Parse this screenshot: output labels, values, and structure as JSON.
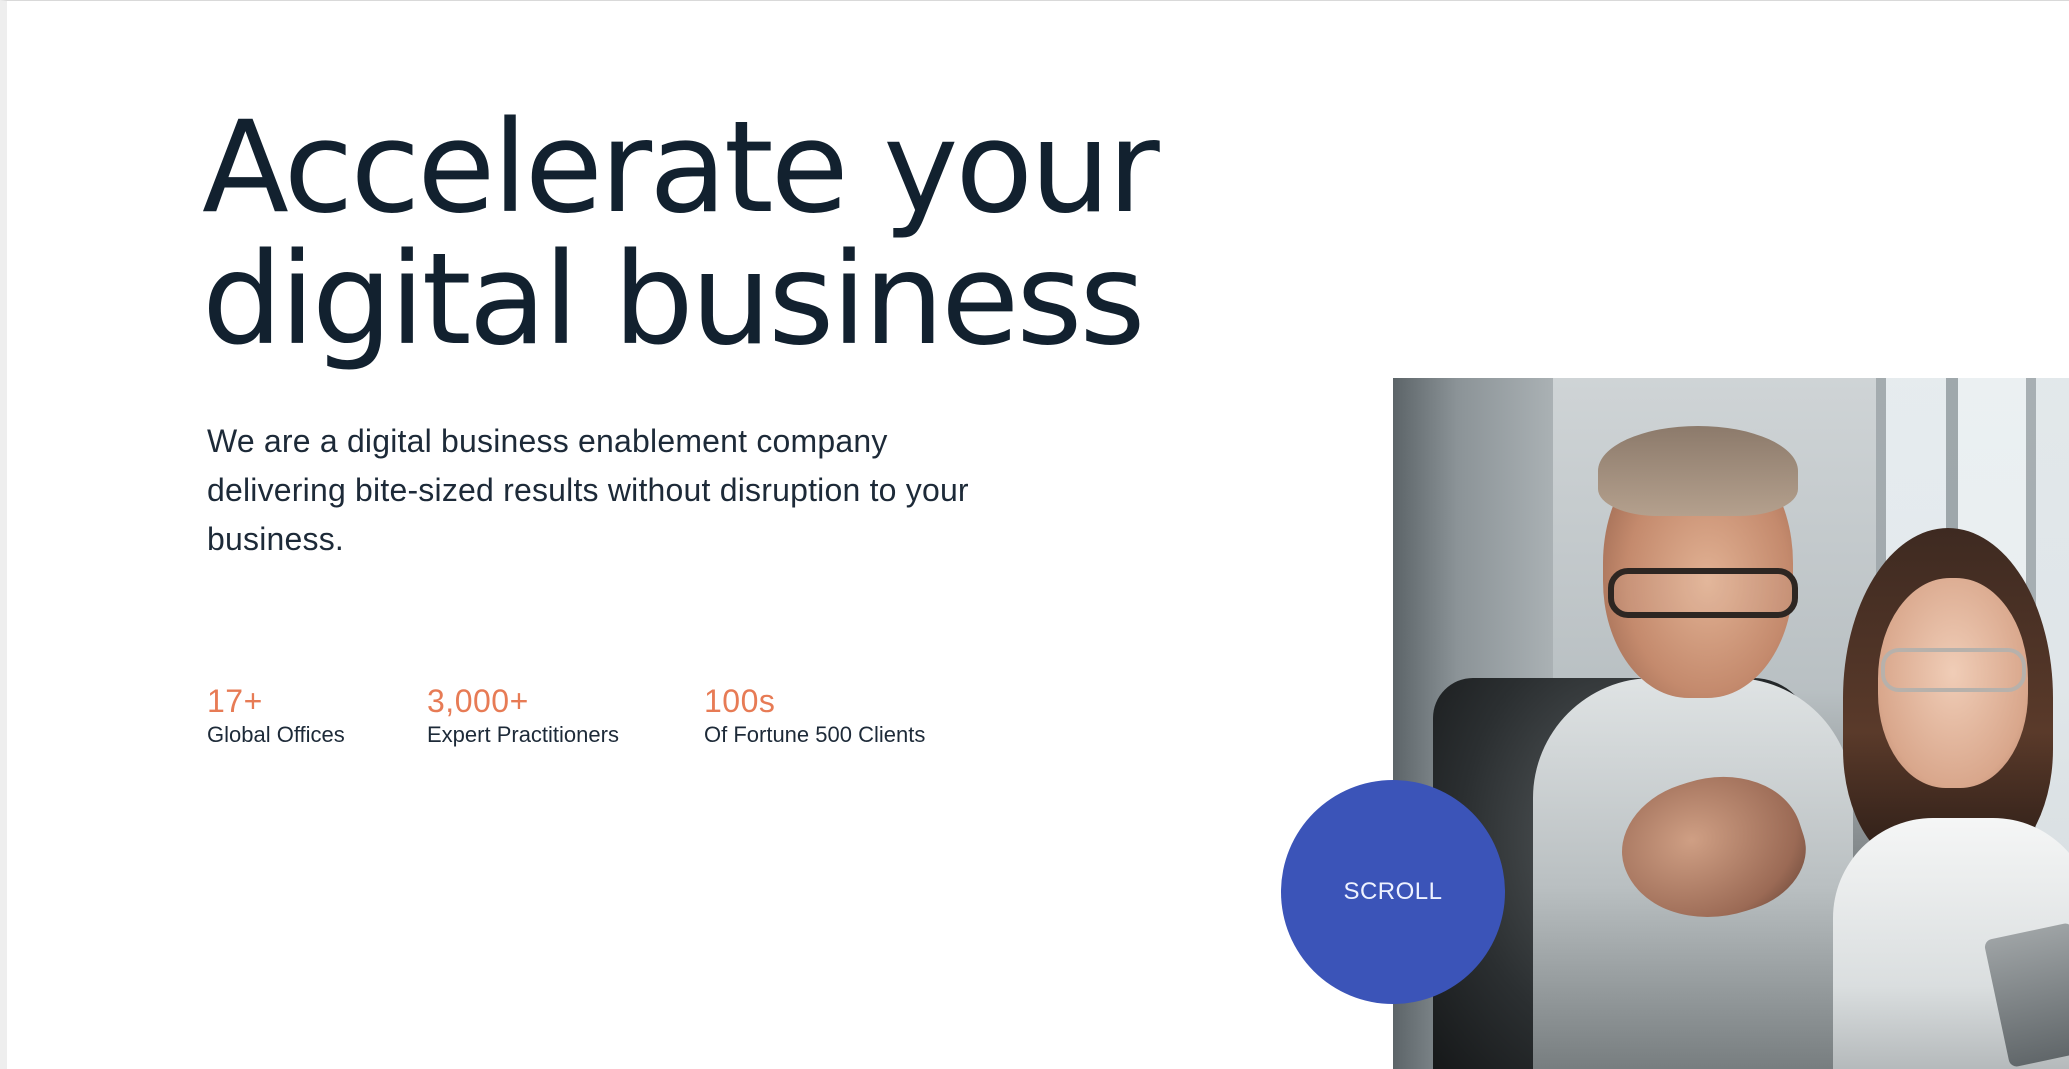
{
  "hero": {
    "headline_line1": "Accelerate your",
    "headline_line2": "digital business",
    "lede": "We are a digital business enablement company delivering bite-sized results without disruption to your business."
  },
  "stats": [
    {
      "value": "17+",
      "label": "Global Offices"
    },
    {
      "value": "3,000+",
      "label": "Expert Practitioners"
    },
    {
      "value": "100s",
      "label": "Of Fortune 500 Clients"
    }
  ],
  "scroll_button": {
    "label": "SCROLL"
  },
  "colors": {
    "headline": "#12212f",
    "accent": "#e77b55",
    "scroll_button": "#3b54b8"
  }
}
